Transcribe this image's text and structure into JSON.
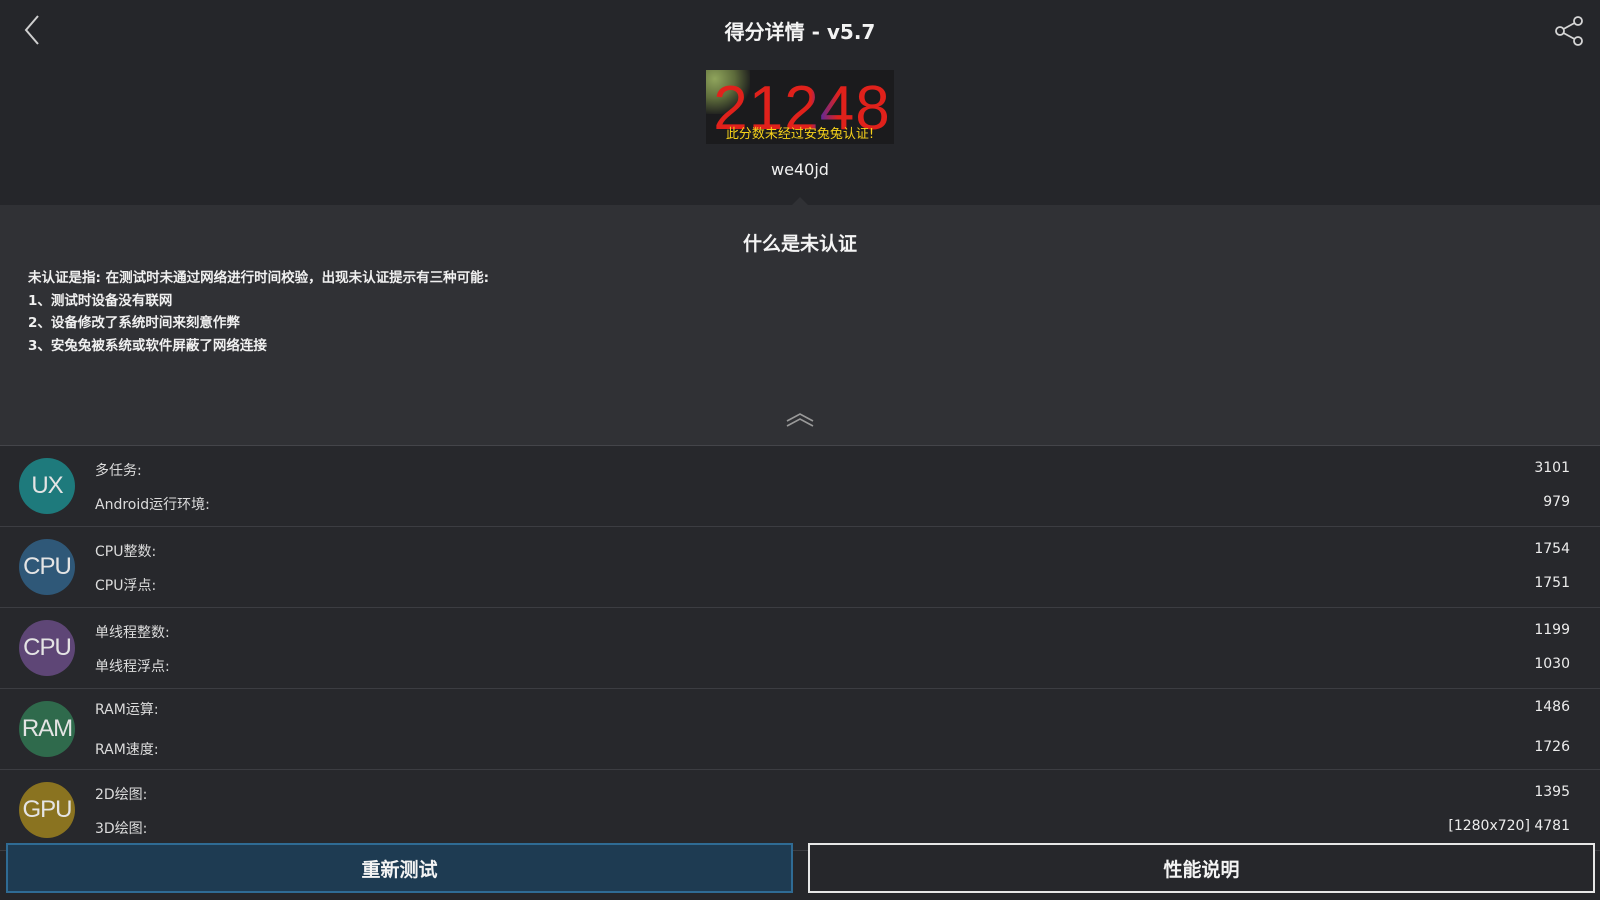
{
  "header": {
    "title": "得分详情 - v5.7",
    "back_icon": "chevron-left-icon",
    "share_icon": "share-icon"
  },
  "score": {
    "value": "21248",
    "note": "此分数未经过安兔兔认证!",
    "device": "we40jd"
  },
  "explain": {
    "title": "什么是未认证",
    "lines": [
      "未认证是指: 在测试时未通过网络进行时间校验，出现未认证提示有三种可能:",
      "1、测试时设备没有联网",
      "2、设备修改了系统时间来刻意作弊",
      "3、安兔兔被系统或软件屏蔽了网络连接"
    ]
  },
  "rows": [
    {
      "badge": "UX",
      "color": "#1e7a7c",
      "items": [
        {
          "label": "多任务:",
          "value": "3101"
        },
        {
          "label": "Android运行环境:",
          "value": "979"
        }
      ]
    },
    {
      "badge": "CPU",
      "color": "#2f5878",
      "items": [
        {
          "label": "CPU整数:",
          "value": "1754"
        },
        {
          "label": "CPU浮点:",
          "value": "1751"
        }
      ]
    },
    {
      "badge": "CPU",
      "color": "#5e4676",
      "items": [
        {
          "label": "单线程整数:",
          "value": "1199"
        },
        {
          "label": "单线程浮点:",
          "value": "1030"
        }
      ]
    },
    {
      "badge": "RAM",
      "color": "#2f6a4c",
      "items": [
        {
          "label": "RAM运算:",
          "value": "1486"
        },
        {
          "label": "RAM速度:",
          "value": "1726"
        }
      ]
    },
    {
      "badge": "GPU",
      "color": "#8a7320",
      "items": [
        {
          "label": "2D绘图:",
          "value": "1395"
        },
        {
          "label": "3D绘图:",
          "value": "[1280x720] 4781"
        }
      ]
    }
  ],
  "buttons": {
    "retest": "重新测试",
    "info": "性能说明"
  },
  "colors": {
    "background": "#25262a",
    "score_red": "#e0211b",
    "note_yellow": "#f6d21a",
    "accent_blue": "#2f6b94"
  }
}
